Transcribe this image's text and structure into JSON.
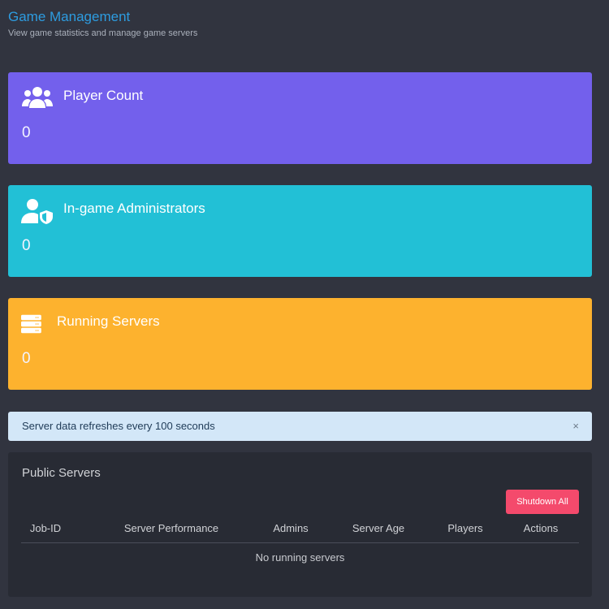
{
  "header": {
    "title": "Game Management",
    "subtitle": "View game statistics and manage game servers"
  },
  "cards": [
    {
      "title": "Player Count",
      "value": "0",
      "icon": "users-icon",
      "color": "#7360ec"
    },
    {
      "title": "In-game Administrators",
      "value": "0",
      "icon": "user-shield-icon",
      "color": "#22c0d6"
    },
    {
      "title": "Running Servers",
      "value": "0",
      "icon": "server-icon",
      "color": "#fdb22e"
    }
  ],
  "alert": {
    "text": "Server data refreshes every 100 seconds",
    "close": "×"
  },
  "servers": {
    "title": "Public Servers",
    "shutdown_label": "Shutdown All",
    "columns": [
      "Job-ID",
      "Server Performance",
      "Admins",
      "Server Age",
      "Players",
      "Actions"
    ],
    "empty": "No running servers"
  }
}
